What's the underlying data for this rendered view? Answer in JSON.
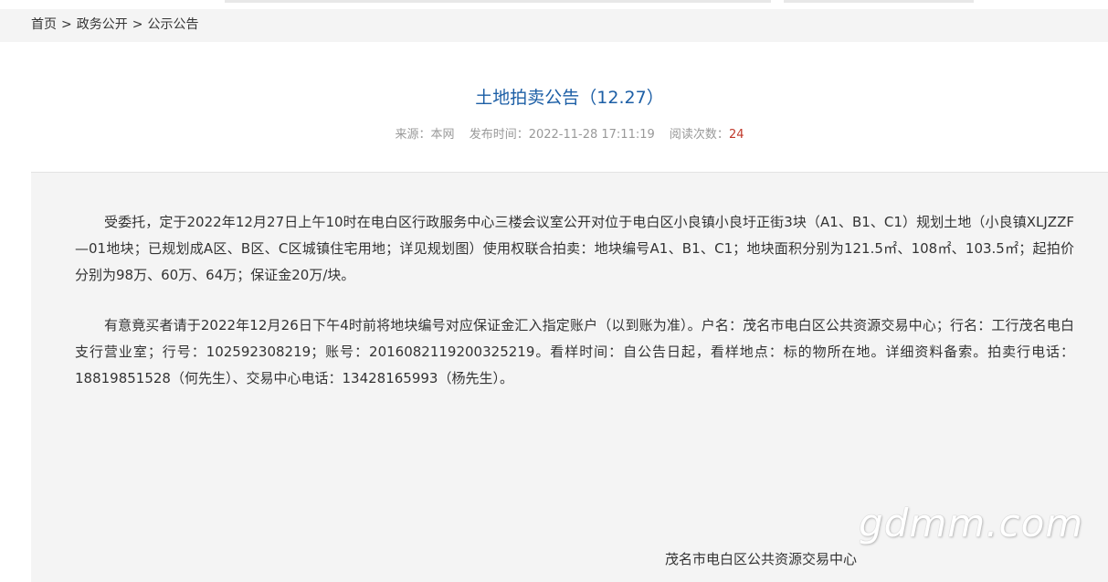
{
  "breadcrumb": {
    "items": [
      {
        "label": "首页"
      },
      {
        "label": "政务公开"
      },
      {
        "label": "公示公告"
      }
    ],
    "separator": ">"
  },
  "article": {
    "title": "土地拍卖公告（12.27）",
    "meta": {
      "source_label": "来源：",
      "source_value": "本网",
      "published_label": "发布时间：",
      "published_value": "2022-11-28 17:11:19",
      "views_label": "阅读次数：",
      "views_value": "24"
    },
    "paragraphs": [
      "受委托，定于2022年12月27日上午10时在电白区行政服务中心三楼会议室公开对位于电白区小良镇小良圩正街3块（A1、B1、C1）规划土地（小良镇XLJZZF—01地块；已规划成A区、B区、C区城镇住宅用地；详见规划图）使用权联合拍卖：地块编号A1、B1、C1；地块面积分别为121.5㎡、108㎡、103.5㎡；起拍价分别为98万、60万、64万；保证金20万/块。",
      "有意竟买者请于2022年12月26日下午4时前将地块编号对应保证金汇入指定账户（以到账为准）。户名：茂名市电白区公共资源交易中心；行名：工行茂名电白支行营业室；行号：102592308219；账号：2016082119200325219。看样时间：自公告日起，看样地点：标的物所在地。详细资料备索。拍卖行电话：18819851528（何先生）、交易中心电话：13428165993（杨先生）。"
    ],
    "signature": "茂名市电白区公共资源交易中心"
  },
  "watermark": "gdmm.com",
  "colors": {
    "title": "#1d5fa6",
    "meta": "#999999",
    "views_count": "#c0392b",
    "content_bg": "#f4f4f4"
  }
}
